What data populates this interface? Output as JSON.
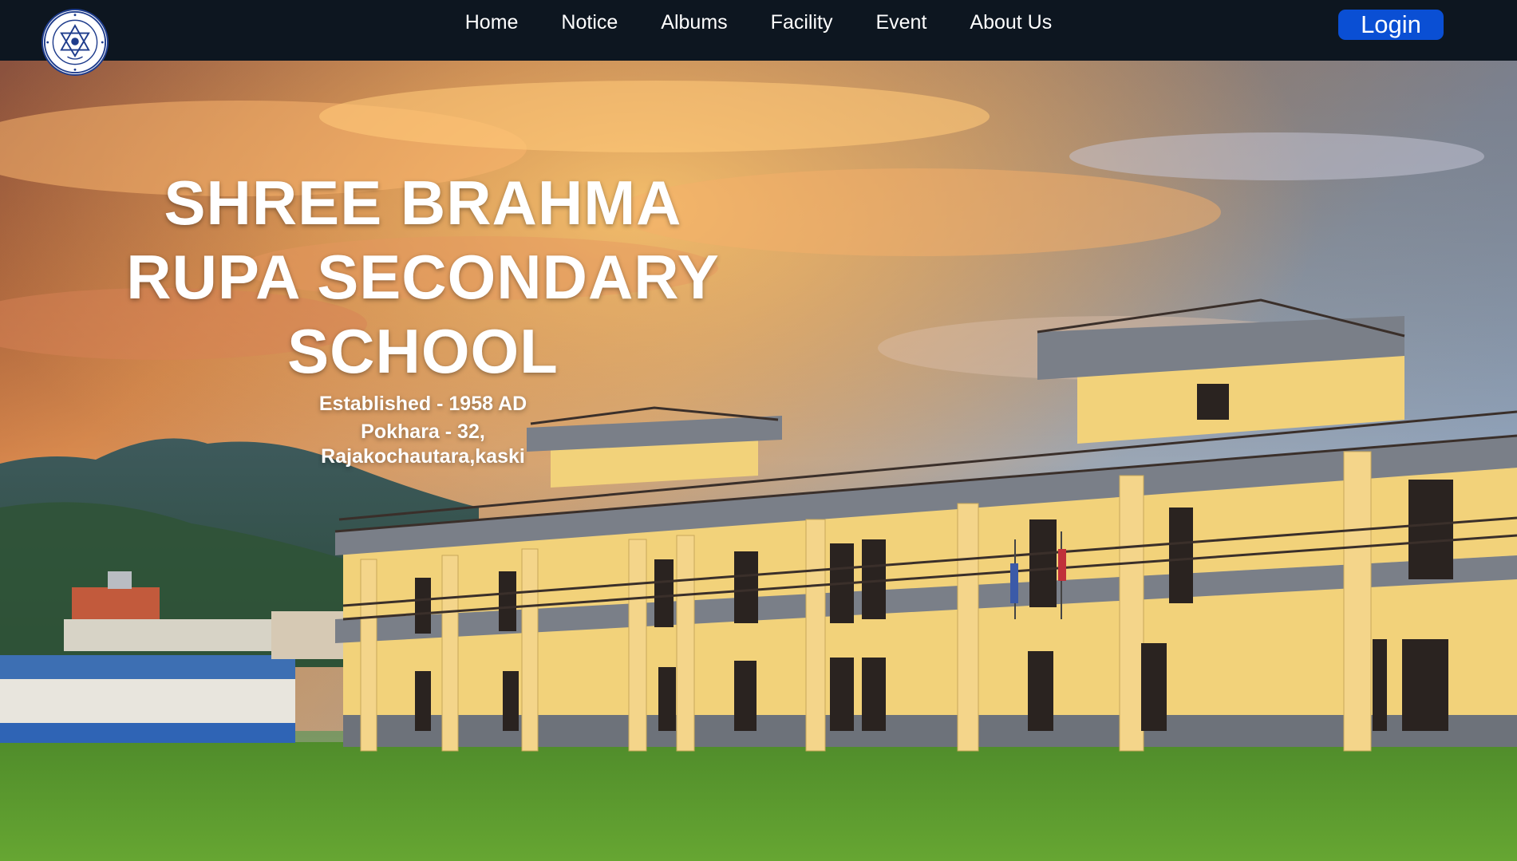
{
  "nav": {
    "items": [
      {
        "label": "Home"
      },
      {
        "label": "Notice"
      },
      {
        "label": "Albums"
      },
      {
        "label": "Facility"
      },
      {
        "label": "Event"
      },
      {
        "label": "About Us"
      }
    ],
    "login_label": "Login",
    "logo_icon": "school-emblem-icon"
  },
  "hero": {
    "title": "SHREE BRAHMA RUPA SECONDARY SCHOOL",
    "established": "Established - 1958 AD",
    "address": "Pokhara - 32, Rajakochautara,kaski"
  },
  "colors": {
    "navbar_bg": "#0d1620",
    "login_bg": "#0a4fd4",
    "nav_text": "#ffffff",
    "building_wall": "#f2d27a",
    "building_trim": "#7a7f88",
    "grass": "#5c9a2e"
  }
}
